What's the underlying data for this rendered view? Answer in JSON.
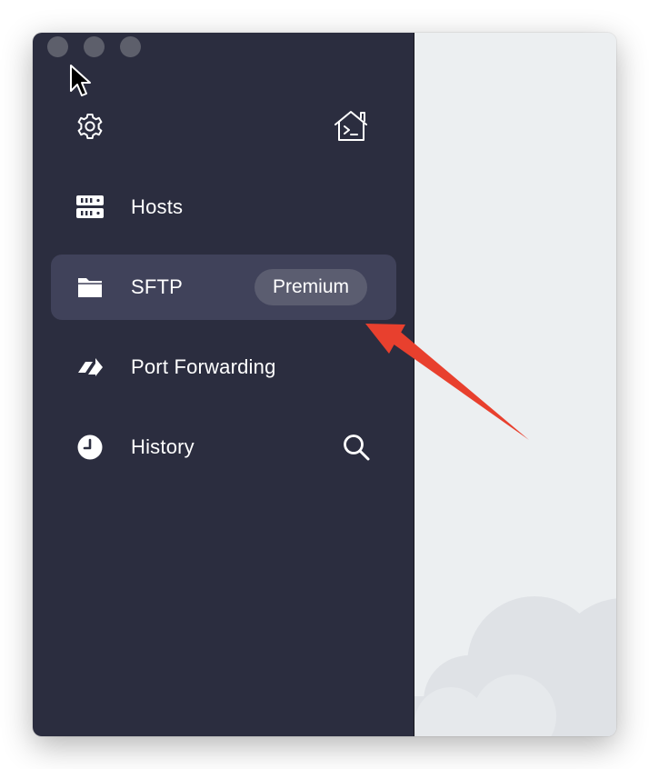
{
  "sidebar": {
    "top_icons": {
      "settings": "gear-icon",
      "local_terminal": "home-terminal-icon"
    },
    "items": [
      {
        "label": "Hosts",
        "icon": "server-icon",
        "active": false
      },
      {
        "label": "SFTP",
        "icon": "folder-icon",
        "active": true,
        "badge": "Premium"
      },
      {
        "label": "Port Forwarding",
        "icon": "port-forward-icon",
        "active": false
      },
      {
        "label": "History",
        "icon": "clock-icon",
        "active": false
      }
    ],
    "history_action": "search-icon"
  },
  "colors": {
    "sidebar_bg": "#2b2d3f",
    "active_item_bg": "#40425a",
    "badge_bg": "#5b5d70",
    "content_bg": "#eceff1",
    "annotation_arrow": "#e8402e"
  }
}
